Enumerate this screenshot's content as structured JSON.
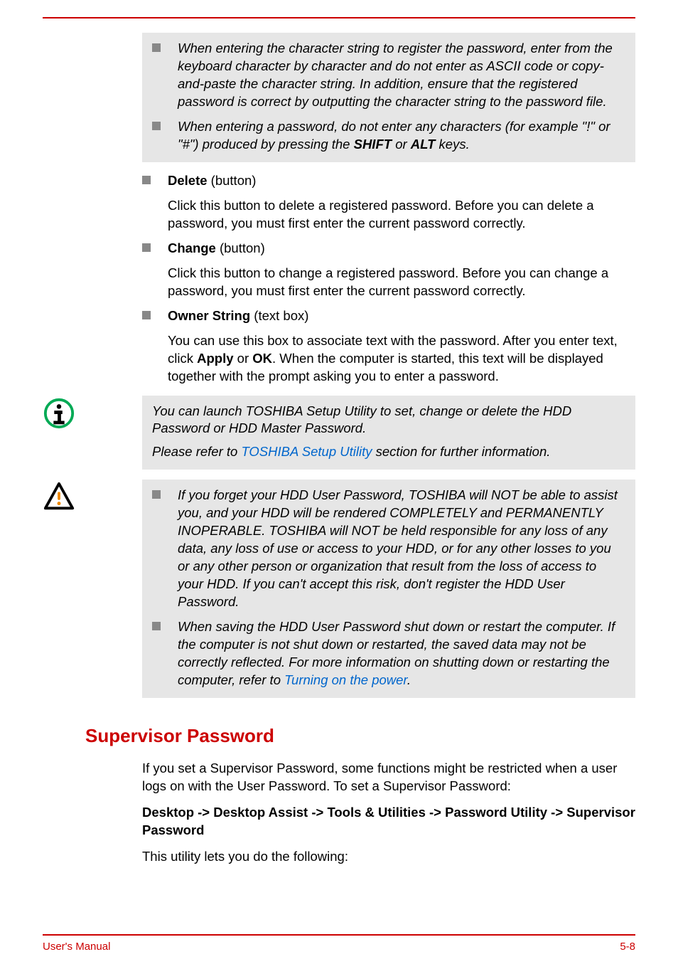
{
  "notes_box1": {
    "item1": {
      "text": "When entering the character string to register the password, enter from the keyboard character by character and do not enter as ASCII code or copy-and-paste the character string. In addition, ensure that the registered password is correct by outputting the character string to the password file."
    },
    "item2": {
      "prefix": "When entering a password, do not enter any characters (for example \"!\" or \"#\") produced by pressing the ",
      "key1": "SHIFT",
      "mid": " or ",
      "key2": "ALT",
      "suffix": " keys."
    }
  },
  "definitions": {
    "delete": {
      "title": "Delete",
      "type": " (button)",
      "desc": "Click this button to delete a registered password. Before you can delete a password, you must first enter the current password correctly."
    },
    "change": {
      "title": "Change",
      "type": " (button)",
      "desc": "Click this button to change a registered password. Before you can change a password, you must first enter the current password correctly."
    },
    "owner": {
      "title": "Owner String",
      "type": " (text box)",
      "desc_prefix": "You can use this box to associate text with the password. After you enter text, click ",
      "b1": "Apply",
      "mid": " or ",
      "b2": "OK",
      "desc_suffix": ". When the computer is started, this text will be displayed together with the prompt asking you to enter a password."
    }
  },
  "info_box": {
    "line1": "You can launch TOSHIBA Setup Utility to set, change or delete the HDD Password or HDD Master Password.",
    "line2_prefix": "Please refer to ",
    "line2_link": "TOSHIBA Setup Utility",
    "line2_suffix": " section for further information."
  },
  "warn_box": {
    "item1": "If you forget your HDD User Password, TOSHIBA will NOT be able to assist you, and your HDD will be rendered COMPLETELY and PERMANENTLY INOPERABLE. TOSHIBA will NOT be held responsible for any loss of any data, any loss of use or access to your HDD, or for any other losses to you or any other person or organization that result from the loss of access to your HDD. If you can't accept this risk, don't register the HDD User Password.",
    "item2_prefix": "When saving the HDD User Password shut down or restart the computer. If the computer is not shut down or restarted, the saved data may not be correctly reflected. For more information on shutting down or restarting the computer, refer to ",
    "item2_link": "Turning on the power",
    "item2_suffix": "."
  },
  "section": {
    "heading": "Supervisor Password",
    "p1": "If you set a Supervisor Password, some functions might be restricted when a user logs on with the User Password. To set a Supervisor Password:",
    "p2": "Desktop -> Desktop Assist -> Tools & Utilities -> Password Utility -> Supervisor Password",
    "p3": "This utility lets you do the following:"
  },
  "footer": {
    "left": "User's Manual",
    "right": "5-8"
  }
}
